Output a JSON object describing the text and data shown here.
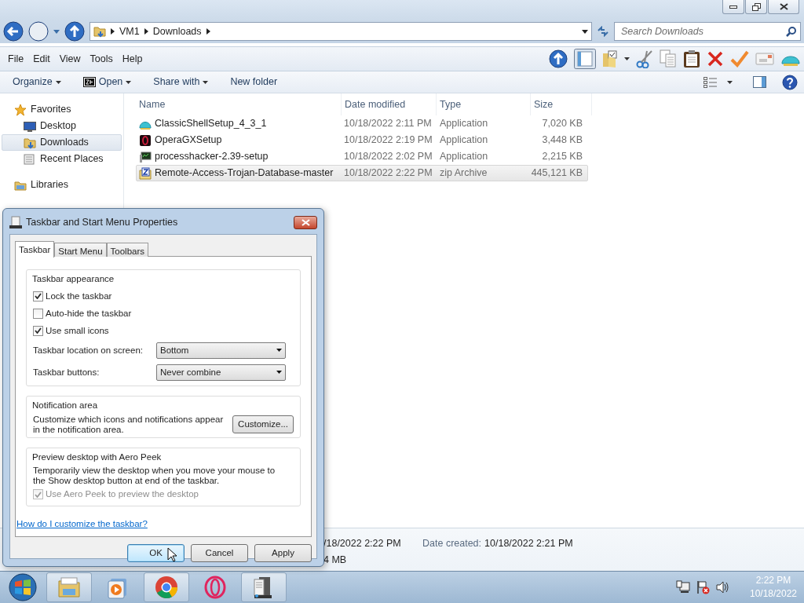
{
  "explorer": {
    "breadcrumb": [
      "VM1",
      "Downloads"
    ],
    "search": {
      "placeholder": "Search Downloads"
    },
    "menu": [
      "File",
      "Edit",
      "View",
      "Tools",
      "Help"
    ],
    "commands": [
      {
        "label": "Organize",
        "dropdown": true,
        "kind": "plain"
      },
      {
        "label": "Open",
        "dropdown": true,
        "kind": "archive"
      },
      {
        "label": "Share with",
        "dropdown": true,
        "kind": "plain"
      },
      {
        "label": "New folder",
        "dropdown": false,
        "kind": "plain"
      }
    ],
    "nav": [
      {
        "label": "Favorites",
        "kind": "star",
        "selected": false,
        "children": [
          {
            "label": "Desktop",
            "kind": "desktop",
            "selected": false
          },
          {
            "label": "Downloads",
            "kind": "downloads",
            "selected": true
          },
          {
            "label": "Recent Places",
            "kind": "recent",
            "selected": false
          }
        ]
      },
      {
        "label": "Libraries",
        "kind": "library",
        "selected": false
      }
    ],
    "columns": [
      "Name",
      "Date modified",
      "Type",
      "Size"
    ],
    "files": [
      {
        "name": "ClassicShellSetup_4_3_1",
        "date": "10/18/2022 2:11 PM",
        "type": "Application",
        "size": "7,020 KB",
        "kind": "shell",
        "selected": false
      },
      {
        "name": "OperaGXSetup",
        "date": "10/18/2022 2:19 PM",
        "type": "Application",
        "size": "3,448 KB",
        "kind": "opera",
        "selected": false
      },
      {
        "name": "processhacker-2.39-setup",
        "date": "10/18/2022 2:02 PM",
        "type": "Application",
        "size": "2,215 KB",
        "kind": "app",
        "selected": false
      },
      {
        "name": "Remote-Access-Trojan-Database-master",
        "date": "10/18/2022 2:22 PM",
        "type": "zip Archive",
        "size": "445,121 KB",
        "kind": "zip",
        "selected": true
      }
    ],
    "details": {
      "modified": "/18/2022 2:22 PM",
      "size": "4 MB",
      "created_label": "Date created:",
      "created": "10/18/2022 2:21 PM"
    }
  },
  "dialog": {
    "title": "Taskbar and Start Menu Properties",
    "tabs": [
      {
        "label": "Taskbar",
        "selected": true
      },
      {
        "label": "Start Menu",
        "selected": false
      },
      {
        "label": "Toolbars",
        "selected": false
      }
    ],
    "appearance": {
      "title": "Taskbar appearance",
      "checkboxes": [
        {
          "label": "Lock the taskbar",
          "checked": true,
          "disabled": false
        },
        {
          "label": "Auto-hide the taskbar",
          "checked": false,
          "disabled": false
        },
        {
          "label": "Use small icons",
          "checked": true,
          "disabled": false
        }
      ],
      "selects": [
        {
          "label": "Taskbar location on screen:",
          "value": "Bottom"
        },
        {
          "label": "Taskbar buttons:",
          "value": "Never combine"
        }
      ]
    },
    "notification": {
      "title": "Notification area",
      "text": "Customize which icons and notifications appear in the notification area.",
      "button": "Customize..."
    },
    "peek": {
      "title": "Preview desktop with Aero Peek",
      "text": "Temporarily view the desktop when you move your mouse to the Show desktop button at end of the taskbar.",
      "checkbox": {
        "label": "Use Aero Peek to preview the desktop",
        "checked": true,
        "disabled": true
      }
    },
    "help_link": "How do I customize the taskbar?",
    "buttons": [
      {
        "label": "OK",
        "default": true
      },
      {
        "label": "Cancel",
        "default": false
      },
      {
        "label": "Apply",
        "default": false
      }
    ]
  },
  "taskbar": {
    "apps": [
      {
        "kind": "explorer",
        "running": true
      },
      {
        "kind": "media",
        "running": false
      },
      {
        "kind": "chrome",
        "running": true
      },
      {
        "kind": "opera",
        "running": false
      },
      {
        "kind": "server",
        "running": true
      }
    ],
    "clock": {
      "time": "2:22 PM",
      "date": "10/18/2022"
    }
  }
}
